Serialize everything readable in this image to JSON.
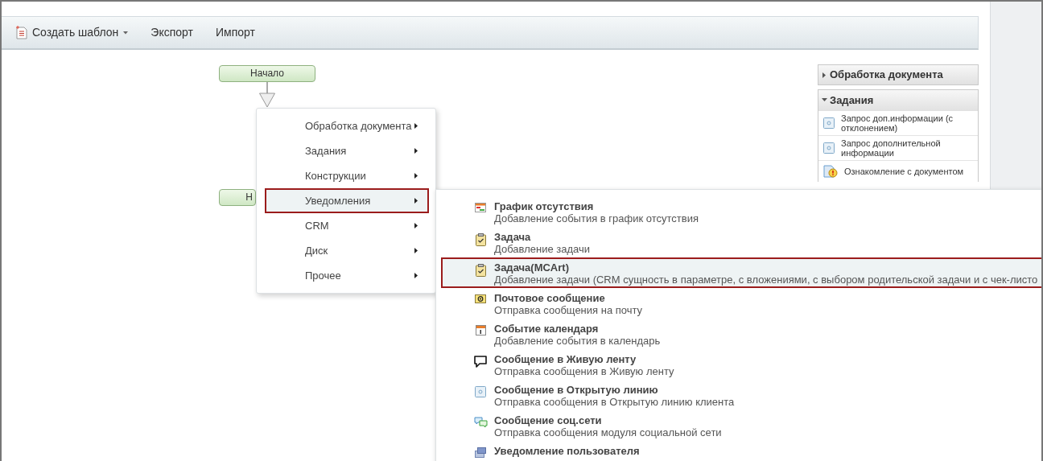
{
  "toolbar": {
    "buttons": [
      {
        "label": "Создать шаблон",
        "kind": "dropdown"
      },
      {
        "label": "Экспорт",
        "kind": "plain"
      },
      {
        "label": "Импорт",
        "kind": "plain"
      }
    ]
  },
  "canvas": {
    "nodes": [
      {
        "label": "Начало"
      },
      {
        "label": "Н"
      }
    ]
  },
  "palette": {
    "sections": [
      {
        "title": "Обработка документа",
        "expanded": false
      },
      {
        "title": "Задания",
        "expanded": true,
        "items": [
          {
            "label": "Запрос доп.информации (с отклонением)",
            "kind": "box"
          },
          {
            "label": "Запрос дополнительной информации",
            "kind": "box"
          },
          {
            "label": "Ознакомление с документом",
            "kind": "warning"
          }
        ]
      }
    ]
  },
  "context_menu": {
    "items": [
      {
        "label": "Обработка документа",
        "selected": false
      },
      {
        "label": "Задания",
        "selected": false
      },
      {
        "label": "Конструкции",
        "selected": false
      },
      {
        "label": "Уведомления",
        "selected": true
      },
      {
        "label": "CRM",
        "selected": false
      },
      {
        "label": "Диск",
        "selected": false
      },
      {
        "label": "Прочее",
        "selected": false
      }
    ]
  },
  "submenu": {
    "items": [
      {
        "title": "График отсутствия",
        "description": "Добавление события в график отсутствия",
        "kind": "schedule",
        "selected": false
      },
      {
        "title": "Задача",
        "description": "Добавление задачи",
        "kind": "task",
        "selected": false
      },
      {
        "title": "Задача(MCArt)",
        "description": "Добавление задачи (CRM сущность в параметре, с вложениями, с выбором родительской задачи и с чек-листо",
        "kind": "task",
        "selected": true
      },
      {
        "title": "Почтовое сообщение",
        "description": "Отправка сообщения на почту",
        "kind": "mail",
        "selected": false
      },
      {
        "title": "Событие календаря",
        "description": "Добавление события в календарь",
        "kind": "calendar",
        "selected": false
      },
      {
        "title": "Сообщение в Живую ленту",
        "description": "Отправка сообщения в Живую ленту",
        "kind": "speech",
        "selected": false
      },
      {
        "title": "Сообщение в Открытую линию",
        "description": "Отправка сообщения в Открытую линию клиента",
        "kind": "box",
        "selected": false
      },
      {
        "title": "Сообщение соц.сети",
        "description": "Отправка сообщения модуля социальной сети",
        "kind": "chat",
        "selected": false
      },
      {
        "title": "Уведомление пользователя",
        "kind": "notify",
        "selected": false
      }
    ]
  }
}
